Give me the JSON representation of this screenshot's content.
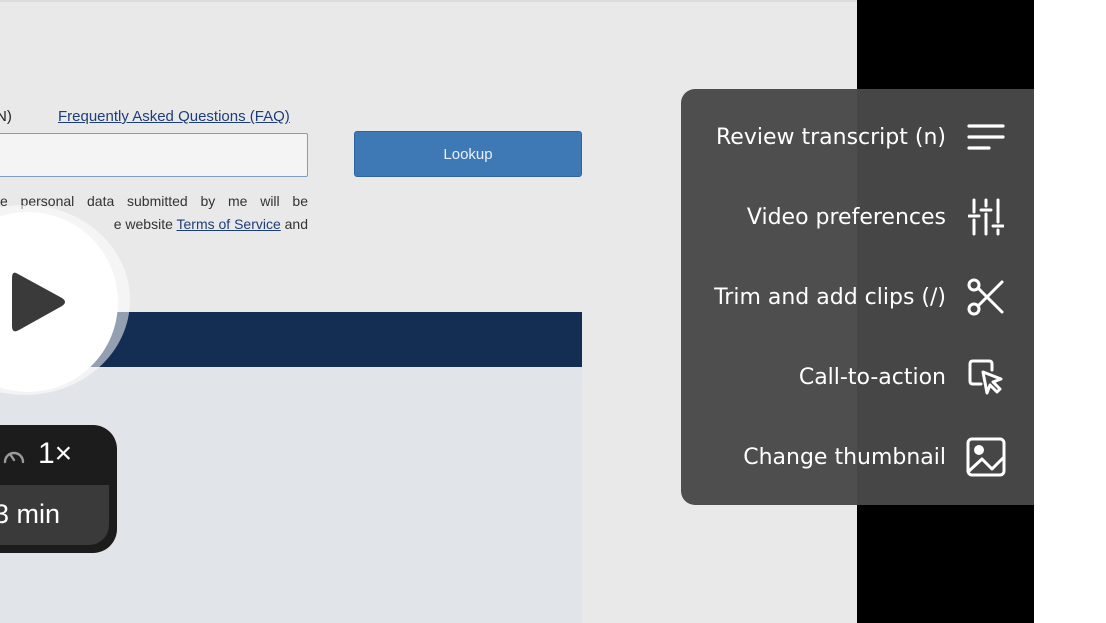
{
  "recorded_page": {
    "faq_prefix": "N)",
    "faq_link": "Frequently Asked Questions (FAQ)",
    "lookup_button": "Lookup",
    "consent_line1": "e personal data submitted by me will be",
    "consent_line2_text": "e website ",
    "terms_link": "Terms of Service",
    "consent_line2_end": " and"
  },
  "player": {
    "speed": "1×",
    "duration": "3 min"
  },
  "menu": {
    "items": [
      {
        "label": "Review transcript (n)",
        "icon": "transcript-lines-icon"
      },
      {
        "label": "Video preferences",
        "icon": "sliders-icon"
      },
      {
        "label": "Trim and add clips (/)",
        "icon": "scissors-icon"
      },
      {
        "label": "Call-to-action",
        "icon": "cursor-click-icon"
      },
      {
        "label": "Change thumbnail",
        "icon": "image-icon"
      }
    ]
  },
  "colors": {
    "menu_bg": "#484848",
    "lookup_button": "#3f79b5",
    "navy_bar": "#132e52"
  }
}
